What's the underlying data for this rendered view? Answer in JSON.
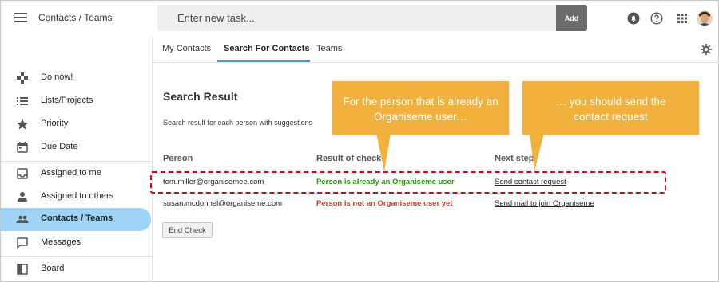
{
  "header": {
    "title": "Contacts / Teams",
    "task_placeholder": "Enter new task...",
    "add_label": "Add"
  },
  "sidebar": {
    "items": [
      {
        "label": "Do now!",
        "icon": "gamepad-icon"
      },
      {
        "label": "Lists/Projects",
        "icon": "list-icon"
      },
      {
        "label": "Priority",
        "icon": "star-icon"
      },
      {
        "label": "Due Date",
        "icon": "calendar-icon"
      },
      {
        "label": "Assigned to me",
        "icon": "inbox-icon"
      },
      {
        "label": "Assigned to others",
        "icon": "person-icon"
      },
      {
        "label": "Contacts / Teams",
        "icon": "people-icon"
      },
      {
        "label": "Messages",
        "icon": "message-icon"
      },
      {
        "label": "Board",
        "icon": "board-icon"
      }
    ],
    "active_index": 6
  },
  "tabs": [
    {
      "label": "My Contacts"
    },
    {
      "label": "Search For Contacts"
    },
    {
      "label": "Teams"
    }
  ],
  "active_tab": 1,
  "main": {
    "title": "Search Result",
    "description": "Search result for each person with suggestions",
    "columns": [
      "Person",
      "Result of check",
      "Next step"
    ],
    "rows": [
      {
        "person": "tom.miller@organisemee.com",
        "result": "Person is already an Organiseme user",
        "result_status": "user",
        "next": "Send contact request"
      },
      {
        "person": "susan.mcdonnel@organiseme.com",
        "result": "Person is not an Organiseme user yet",
        "result_status": "not-user",
        "next": "Send mail to join Organiseme"
      }
    ],
    "end_button": "End Check"
  },
  "callouts": {
    "left": "For the person that is already an Organiseme user…",
    "right": "… you should send the contact request"
  },
  "colors": {
    "accent": "#4ba3e3",
    "active_sidebar": "#9fd4f7",
    "callout": "#f2b13c",
    "success": "#2f8f17",
    "error": "#d9352c",
    "highlight_border": "#d0021b"
  }
}
